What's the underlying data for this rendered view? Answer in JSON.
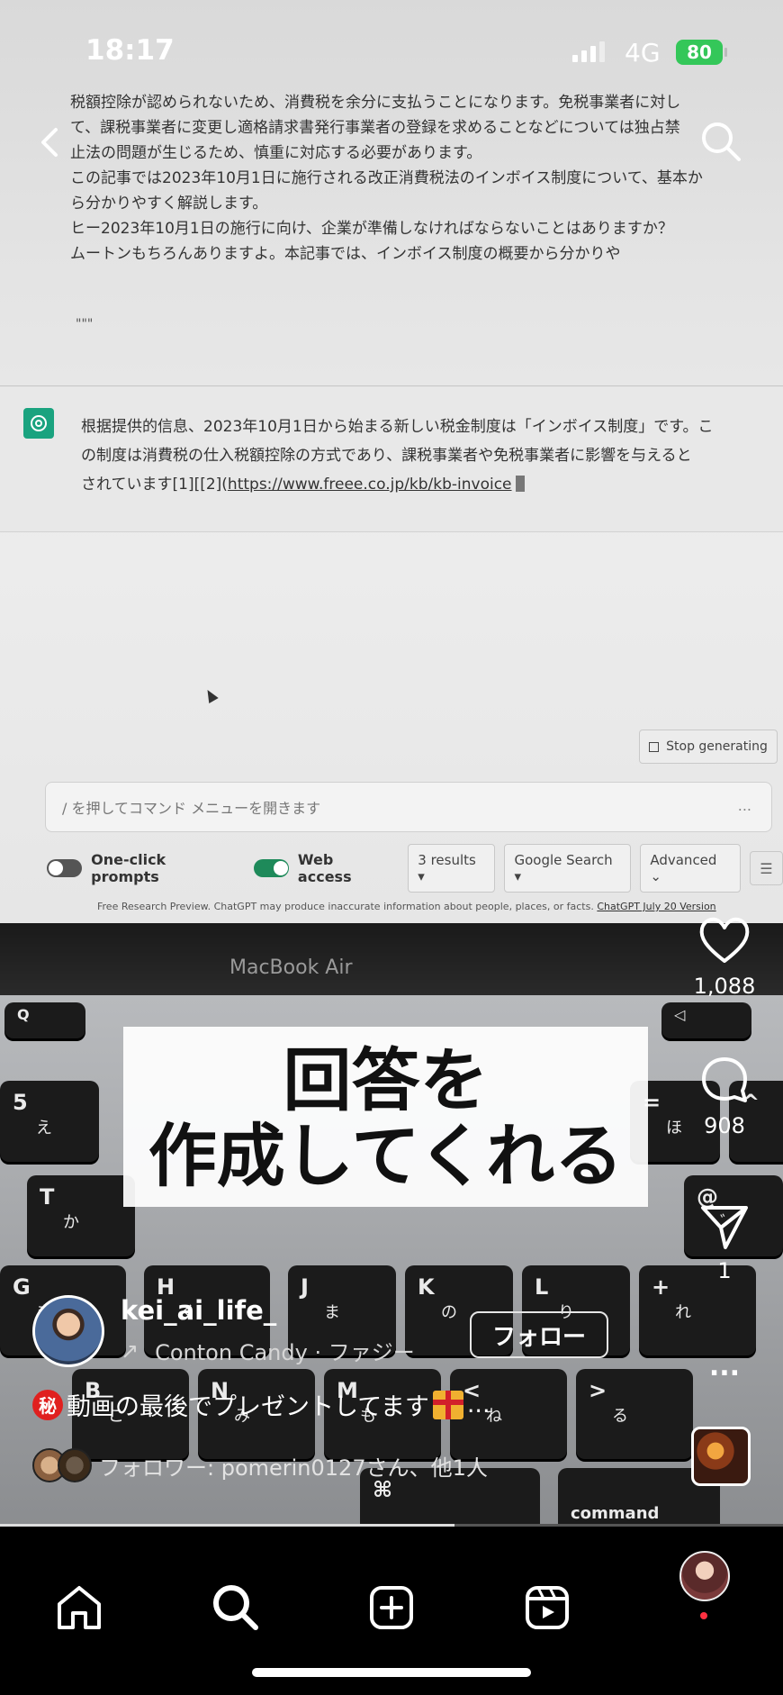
{
  "status_bar": {
    "time": "18:17",
    "network": "4G",
    "battery": "80"
  },
  "video_content": {
    "previous_text_lines": [
      "税額控除が認められないため、消費税を余分に支払うことになります。免税事業者に対し",
      "て、課税事業者に変更し適格請求書発行事業者の登録を求めることなどについては独占禁",
      "止法の問題が生じるため、慎重に対応する必要があります。",
      "この記事では2023年10月1日に施行される改正消費税法のインボイス制度について、基本か",
      "ら分かりやすく解説します。",
      "ヒー2023年10月1日の施行に向け、企業が準備しなければならないことはありますか？",
      "ムートンもちろんありますよ。本記事では、インボイス制度の概要から分かりや"
    ],
    "quote_mark": "\"\"\"",
    "answer_lines": [
      "根据提供的信息、2023年10月1日から始まる新しい税金制度は「インボイス制度」です。こ",
      "の制度は消費税の仕入税額控除の方式であり、課税事業者や免税事業者に影響を与えると"
    ],
    "answer_last_prefix": "されています[1][[2](",
    "answer_link": "https://www.freee.co.jp/kb/kb-invoice",
    "stop_button": "Stop generating",
    "command_placeholder": "/ を押してコマンド メニューを開きます",
    "command_dots": "...",
    "toolbar": {
      "one_click_prompts": "One-click prompts",
      "web_access": "Web access",
      "results": "3 results",
      "search_engine": "Google Search",
      "advanced": "Advanced"
    },
    "footnote_text": "Free Research Preview. ChatGPT may produce inaccurate information about people, places, or facts.",
    "footnote_link": "ChatGPT July 20 Version",
    "device_label": "MacBook Air"
  },
  "caption": {
    "line1": "回答を",
    "line2": "作成してくれる"
  },
  "actions": {
    "likes": "1,088",
    "comments": "908",
    "shares": "1",
    "more": "..."
  },
  "author": {
    "username": "kei_ai_life_",
    "music": "Conton Candy · ファジー",
    "follow_label": "フォロー"
  },
  "description": {
    "badge": "秘",
    "text": "動画の最後でプレゼントしてます",
    "ellipsis": "..."
  },
  "followers_line": "フォロワー: pomerin0127さん、他1人",
  "progress": 0.58,
  "icons": [
    "back-icon",
    "search-icon",
    "heart-icon",
    "comment-icon",
    "share-icon",
    "more-icon",
    "home-icon",
    "search-nav-icon",
    "create-icon",
    "reels-icon",
    "profile-avatar"
  ],
  "colors": {
    "accent_green": "#34c759",
    "gpt_green": "#1aa37f",
    "notification_red": "#ff3040"
  }
}
